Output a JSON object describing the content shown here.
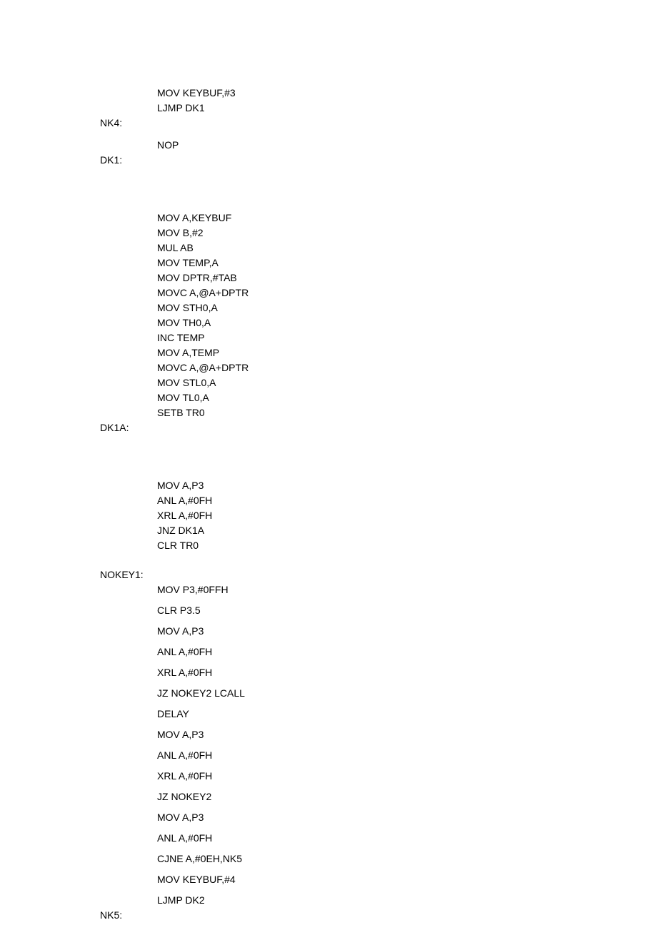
{
  "lines": [
    {
      "class": "instruction",
      "text": "MOV KEYBUF,#3"
    },
    {
      "class": "instruction",
      "text": "LJMP DK1"
    },
    {
      "class": "label",
      "text": "NK4:"
    },
    {
      "class": "spacer",
      "text": ""
    },
    {
      "class": "instruction",
      "text": "NOP"
    },
    {
      "class": "label",
      "text": "DK1:"
    },
    {
      "class": "block-spacer",
      "text": ""
    },
    {
      "class": "instruction",
      "text": "MOV A,KEYBUF"
    },
    {
      "class": "instruction",
      "text": "MOV B,#2"
    },
    {
      "class": "instruction",
      "text": "MUL AB"
    },
    {
      "class": "instruction",
      "text": "MOV TEMP,A"
    },
    {
      "class": "instruction",
      "text": "MOV DPTR,#TAB"
    },
    {
      "class": "instruction",
      "text": "MOVC A,@A+DPTR"
    },
    {
      "class": "instruction",
      "text": "MOV STH0,A"
    },
    {
      "class": "instruction",
      "text": "MOV TH0,A"
    },
    {
      "class": "instruction",
      "text": "INC TEMP"
    },
    {
      "class": "instruction",
      "text": "MOV A,TEMP"
    },
    {
      "class": "instruction",
      "text": "MOVC A,@A+DPTR"
    },
    {
      "class": "instruction",
      "text": "MOV STL0,A"
    },
    {
      "class": "instruction",
      "text": "MOV TL0,A"
    },
    {
      "class": "instruction",
      "text": "SETB TR0"
    },
    {
      "class": "label",
      "text": "DK1A:"
    },
    {
      "class": "block-spacer",
      "text": ""
    },
    {
      "class": "instruction",
      "text": "MOV A,P3"
    },
    {
      "class": "instruction",
      "text": "ANL A,#0FH"
    },
    {
      "class": "instruction",
      "text": "XRL A,#0FH"
    },
    {
      "class": "instruction",
      "text": "JNZ DK1A"
    },
    {
      "class": "instruction",
      "text": "CLR TR0"
    },
    {
      "class": "small-spacer",
      "text": ""
    },
    {
      "class": "label",
      "text": "NOKEY1:"
    },
    {
      "class": "instruction",
      "text": "MOV P3,#0FFH"
    },
    {
      "class": "tiny-spacer",
      "text": ""
    },
    {
      "class": "instruction",
      "text": "CLR P3.5"
    },
    {
      "class": "tiny-spacer",
      "text": ""
    },
    {
      "class": "instruction",
      "text": "MOV A,P3"
    },
    {
      "class": "tiny-spacer",
      "text": ""
    },
    {
      "class": "instruction",
      "text": "ANL A,#0FH"
    },
    {
      "class": "tiny-spacer",
      "text": ""
    },
    {
      "class": "instruction",
      "text": "XRL A,#0FH"
    },
    {
      "class": "tiny-spacer",
      "text": ""
    },
    {
      "class": "instruction",
      "text": "JZ NOKEY2 LCALL"
    },
    {
      "class": "tiny-spacer",
      "text": ""
    },
    {
      "class": "instruction",
      "text": "DELAY"
    },
    {
      "class": "tiny-spacer",
      "text": ""
    },
    {
      "class": "instruction",
      "text": "MOV A,P3"
    },
    {
      "class": "tiny-spacer",
      "text": ""
    },
    {
      "class": "instruction",
      "text": "ANL A,#0FH"
    },
    {
      "class": "tiny-spacer",
      "text": ""
    },
    {
      "class": "instruction",
      "text": "XRL A,#0FH"
    },
    {
      "class": "tiny-spacer",
      "text": ""
    },
    {
      "class": "instruction",
      "text": "JZ NOKEY2"
    },
    {
      "class": "tiny-spacer",
      "text": ""
    },
    {
      "class": "instruction",
      "text": "MOV A,P3"
    },
    {
      "class": "tiny-spacer",
      "text": ""
    },
    {
      "class": "instruction",
      "text": "ANL A,#0FH"
    },
    {
      "class": "tiny-spacer",
      "text": ""
    },
    {
      "class": "instruction",
      "text": "CJNE A,#0EH,NK5"
    },
    {
      "class": "tiny-spacer",
      "text": ""
    },
    {
      "class": "instruction",
      "text": "MOV KEYBUF,#4"
    },
    {
      "class": "tiny-spacer",
      "text": ""
    },
    {
      "class": "instruction",
      "text": "LJMP DK2"
    },
    {
      "class": "label",
      "text": "NK5:"
    }
  ]
}
